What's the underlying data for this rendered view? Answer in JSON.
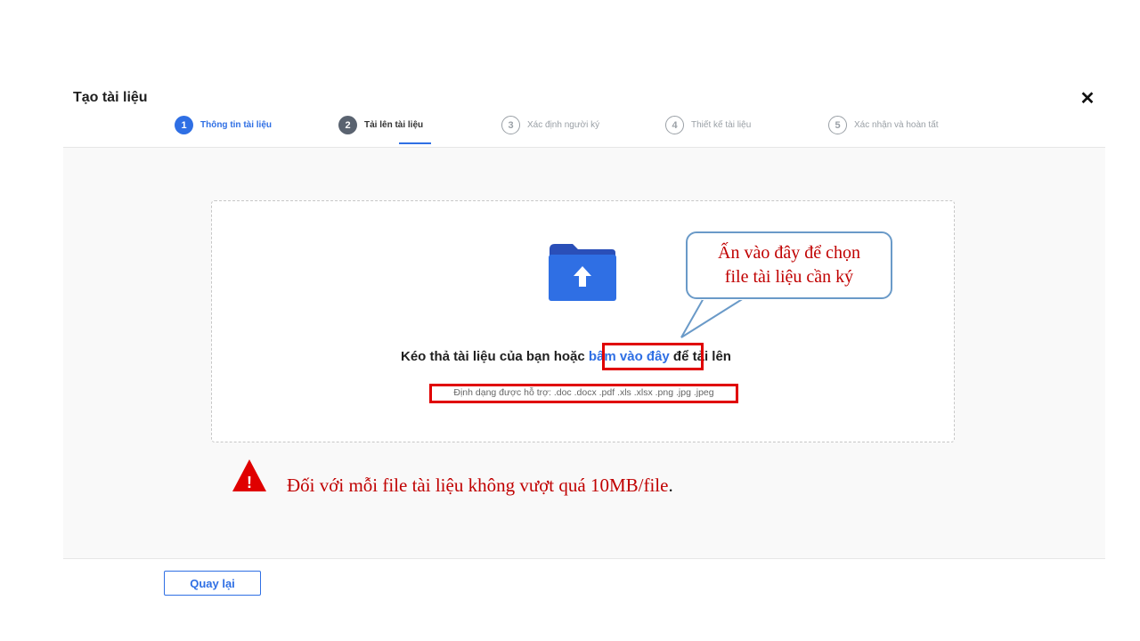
{
  "modal": {
    "title": "Tạo tài liệu",
    "close_icon": "close-icon",
    "close_glyph": "✕"
  },
  "stepper": {
    "steps": [
      {
        "number": "1",
        "label": "Thông tin tài liệu",
        "state": "completed"
      },
      {
        "number": "2",
        "label": "Tải lên tài liệu",
        "state": "current"
      },
      {
        "number": "3",
        "label": "Xác định người ký",
        "state": "pending"
      },
      {
        "number": "4",
        "label": "Thiết kế tài liệu",
        "state": "pending"
      },
      {
        "number": "5",
        "label": "Xác nhận và hoàn tất",
        "state": "pending"
      }
    ]
  },
  "upload": {
    "icon": "folder-upload-icon",
    "text_before": "Kéo thả tài liệu của bạn hoặc ",
    "link_text": "bấm vào đây",
    "text_after": " để tải lên",
    "formats": "Định dạng được hỗ trợ: .doc .docx .pdf .xls .xlsx .png .jpg .jpeg"
  },
  "annotation": {
    "callout_line1": "Ấn vào đây để chọn",
    "callout_line2": "file tài liệu cần ký",
    "warning_icon": "warning-icon",
    "warning_mark": "!",
    "warning_text": "Đối với mỗi file tài liệu không vượt quá 10MB/file",
    "warning_end": "."
  },
  "footer": {
    "back_label": "Quay lại"
  },
  "colors": {
    "primary": "#2f6fe4",
    "annotation_red": "#e00000",
    "callout_border": "#6a9ac8"
  }
}
